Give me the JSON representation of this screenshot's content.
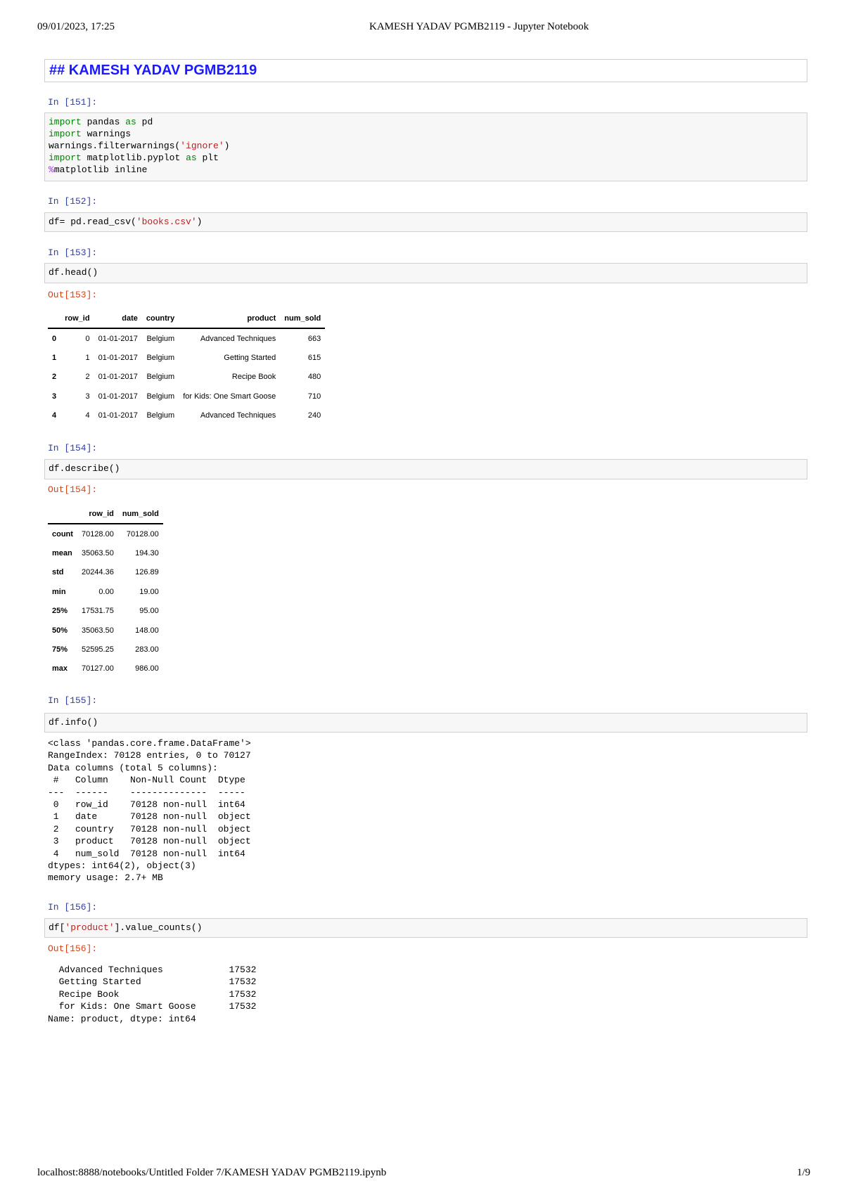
{
  "page_header": {
    "datetime": "09/01/2023, 17:25",
    "title": "KAMESH YADAV PGMB2119 - Jupyter Notebook"
  },
  "markdown_cell": "## KAMESH YADAV PGMB2119",
  "cells": [
    {
      "prompt": "In [151]:",
      "code": [
        [
          "kw",
          "import"
        ],
        [
          "",
          "pandas"
        ],
        [
          "kw",
          "as"
        ],
        [
          "",
          "pd"
        ],
        [
          "kw",
          "import"
        ],
        [
          "",
          "warnings"
        ],
        [
          "",
          "warnings.filterwarnings("
        ],
        [
          "str",
          "'ignore'"
        ],
        [
          "",
          ")"
        ],
        [
          "kw",
          "import"
        ],
        [
          "",
          "matplotlib.pyplot"
        ],
        [
          "kw",
          "as"
        ],
        [
          "",
          "plt"
        ],
        [
          "mag",
          "%"
        ],
        [
          "",
          "matplotlib inline"
        ]
      ]
    },
    {
      "prompt": "In [152]:",
      "code_pre": "df= pd.read_csv(",
      "code_str": "'books.csv'",
      "code_post": ")"
    },
    {
      "prompt": "In [153]:",
      "code": "df.head()",
      "out_prompt": "Out[153]:"
    },
    {
      "prompt": "In [154]:",
      "code": "df.describe()",
      "out_prompt": "Out[154]:"
    },
    {
      "prompt": "In [155]:",
      "code": "df.info()"
    },
    {
      "prompt": "In [156]:",
      "code_pre": "df[",
      "code_str": "'product'",
      "code_post": "].value_counts()",
      "out_prompt": "Out[156]:"
    }
  ],
  "head_table": {
    "columns": [
      "",
      "row_id",
      "date",
      "country",
      "product",
      "num_sold"
    ],
    "rows": [
      [
        "0",
        "0",
        "01-01-2017",
        "Belgium",
        "Advanced Techniques",
        "663"
      ],
      [
        "1",
        "1",
        "01-01-2017",
        "Belgium",
        "Getting Started",
        "615"
      ],
      [
        "2",
        "2",
        "01-01-2017",
        "Belgium",
        "Recipe Book",
        "480"
      ],
      [
        "3",
        "3",
        "01-01-2017",
        "Belgium",
        "for Kids: One Smart Goose",
        "710"
      ],
      [
        "4",
        "4",
        "01-01-2017",
        "Belgium",
        "Advanced Techniques",
        "240"
      ]
    ]
  },
  "describe_table": {
    "columns": [
      "",
      "row_id",
      "num_sold"
    ],
    "rows": [
      [
        "count",
        "70128.00",
        "70128.00"
      ],
      [
        "mean",
        "35063.50",
        "194.30"
      ],
      [
        "std",
        "20244.36",
        "126.89"
      ],
      [
        "min",
        "0.00",
        "19.00"
      ],
      [
        "25%",
        "17531.75",
        "95.00"
      ],
      [
        "50%",
        "35063.50",
        "148.00"
      ],
      [
        "75%",
        "52595.25",
        "283.00"
      ],
      [
        "max",
        "70127.00",
        "986.00"
      ]
    ]
  },
  "info_output": [
    "<class 'pandas.core.frame.DataFrame'>",
    "RangeIndex: 70128 entries, 0 to 70127",
    "Data columns (total 5 columns):",
    " #   Column    Non-Null Count  Dtype ",
    "---  ------    --------------  ----- ",
    " 0   row_id    70128 non-null  int64 ",
    " 1   date      70128 non-null  object",
    " 2   country   70128 non-null  object",
    " 3   product   70128 non-null  object",
    " 4   num_sold  70128 non-null  int64 ",
    "dtypes: int64(2), object(3)",
    "memory usage: 2.7+ MB"
  ],
  "value_counts_output": [
    "  Advanced Techniques            17532",
    "  Getting Started                17532",
    "  Recipe Book                    17532",
    "  for Kids: One Smart Goose      17532",
    "Name: product, dtype: int64"
  ],
  "page_footer": {
    "url": "localhost:8888/notebooks/Untitled Folder 7/KAMESH YADAV PGMB2119.ipynb",
    "page": "1/9"
  }
}
